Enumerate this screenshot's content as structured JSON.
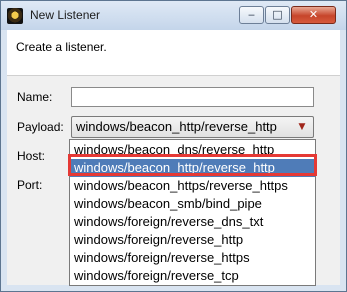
{
  "window": {
    "title": "New Listener",
    "minimize_glyph": "‒",
    "maximize_glyph": "□",
    "close_glyph": "✕"
  },
  "description": "Create a listener.",
  "form": {
    "name_label": "Name:",
    "name_value": "",
    "payload_label": "Payload:",
    "payload_value": "windows/beacon_http/reverse_http",
    "host_label": "Host:",
    "port_label": "Port:"
  },
  "dropdown": {
    "options": [
      "windows/beacon_dns/reverse_http",
      "windows/beacon_http/reverse_http",
      "windows/beacon_https/reverse_https",
      "windows/beacon_smb/bind_pipe",
      "windows/foreign/reverse_dns_txt",
      "windows/foreign/reverse_http",
      "windows/foreign/reverse_https",
      "windows/foreign/reverse_tcp"
    ],
    "selected": "windows/beacon_http/reverse_http",
    "highlight_color": "#e53935",
    "selection_color": "#4f7cb8"
  },
  "icons": {
    "app": "cobalt-strike-app-icon",
    "dropdown": "chevron-down-icon"
  }
}
